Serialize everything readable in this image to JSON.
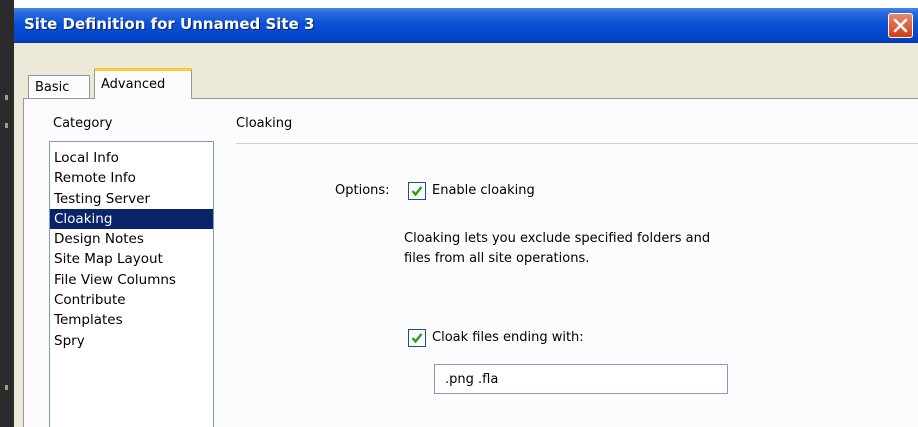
{
  "window": {
    "title": "Site Definition for Unnamed Site 3",
    "close_label": "×",
    "title_bar_color": "#0a50d8"
  },
  "tabs": [
    {
      "label": "Basic",
      "selected": false
    },
    {
      "label": "Advanced",
      "selected": true
    }
  ],
  "sidebar": {
    "heading": "Category",
    "items": [
      {
        "label": "Local Info",
        "selected": false
      },
      {
        "label": "Remote Info",
        "selected": false
      },
      {
        "label": "Testing Server",
        "selected": false
      },
      {
        "label": "Cloaking",
        "selected": true
      },
      {
        "label": "Design Notes",
        "selected": false
      },
      {
        "label": "Site Map Layout",
        "selected": false
      },
      {
        "label": "File View Columns",
        "selected": false
      },
      {
        "label": "Contribute",
        "selected": false
      },
      {
        "label": "Templates",
        "selected": false
      },
      {
        "label": "Spry",
        "selected": false
      }
    ],
    "selection_color": "#0a246a"
  },
  "main": {
    "section_title": "Cloaking",
    "options_label": "Options:",
    "enable_cloaking": {
      "label": "Enable cloaking",
      "checked": true
    },
    "description_lines": [
      "Cloaking lets you exclude specified folders and",
      "files from all site operations."
    ],
    "cloak_files": {
      "label": "Cloak files ending with:",
      "checked": true
    },
    "extensions_value": ".png .fla"
  },
  "icons": {
    "close": "close-icon",
    "checkmark": "checkmark-icon"
  }
}
